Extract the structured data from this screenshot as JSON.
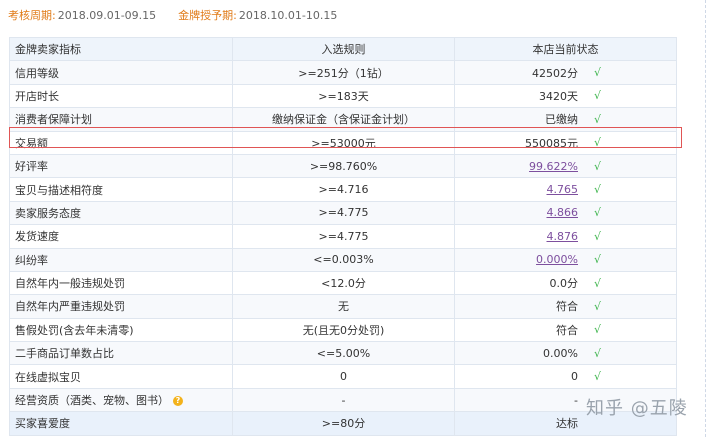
{
  "periods": [
    {
      "label": "考核周期:",
      "value": "2018.09.01-09.15"
    },
    {
      "label": "金牌授予期:",
      "value": "2018.10.01-10.15"
    }
  ],
  "table": {
    "headers": [
      "金牌卖家指标",
      "入选规则",
      "本店当前状态"
    ],
    "rows": [
      {
        "indicator": "信用等级",
        "rule": ">=251分（1钻）",
        "status": "42502分",
        "check": "√",
        "link": false
      },
      {
        "indicator": "开店时长",
        "rule": ">=183天",
        "status": "3420天",
        "check": "√",
        "link": false
      },
      {
        "indicator": "消费者保障计划",
        "rule": "缴纳保证金（含保证金计划）",
        "status": "已缴纳",
        "check": "√",
        "link": false
      },
      {
        "indicator": "交易额",
        "rule": ">=53000元",
        "status": "550085元",
        "check": "√",
        "link": false
      },
      {
        "indicator": "好评率",
        "rule": ">=98.760%",
        "status": "99.622%",
        "check": "√",
        "link": true,
        "purple": true
      },
      {
        "indicator": "宝贝与描述相符度",
        "rule": ">=4.716",
        "status": "4.765",
        "check": "√",
        "link": true,
        "purple": true
      },
      {
        "indicator": "卖家服务态度",
        "rule": ">=4.775",
        "status": "4.866",
        "check": "√",
        "link": true,
        "purple": true
      },
      {
        "indicator": "发货速度",
        "rule": ">=4.775",
        "status": "4.876",
        "check": "√",
        "link": true,
        "purple": true
      },
      {
        "indicator": "纠纷率",
        "rule": "<=0.003%",
        "status": "0.000%",
        "check": "√",
        "link": true,
        "purple": true
      },
      {
        "indicator": "自然年内一般违规处罚",
        "rule": "<12.0分",
        "status": "0.0分",
        "check": "√",
        "link": false
      },
      {
        "indicator": "自然年内严重违规处罚",
        "rule": "无",
        "status": "符合",
        "check": "√",
        "link": false
      },
      {
        "indicator": "售假处罚(含去年未清零)",
        "rule": "无(且无0分处罚)",
        "status": "符合",
        "check": "√",
        "link": false
      },
      {
        "indicator": "二手商品订单数占比",
        "rule": "<=5.00%",
        "status": "0.00%",
        "check": "√",
        "link": false
      },
      {
        "indicator": "在线虚拟宝贝",
        "rule": "0",
        "status": "0",
        "check": "√",
        "link": false
      },
      {
        "indicator": "经营资质（酒类、宠物、图书）",
        "rule": "-",
        "status": "-",
        "check": "",
        "link": false,
        "help": "?"
      },
      {
        "indicator": "买家喜爱度",
        "rule": ">=80分",
        "status": "达标",
        "check": "",
        "link": false
      }
    ]
  },
  "watermark": "知乎 @五陵"
}
